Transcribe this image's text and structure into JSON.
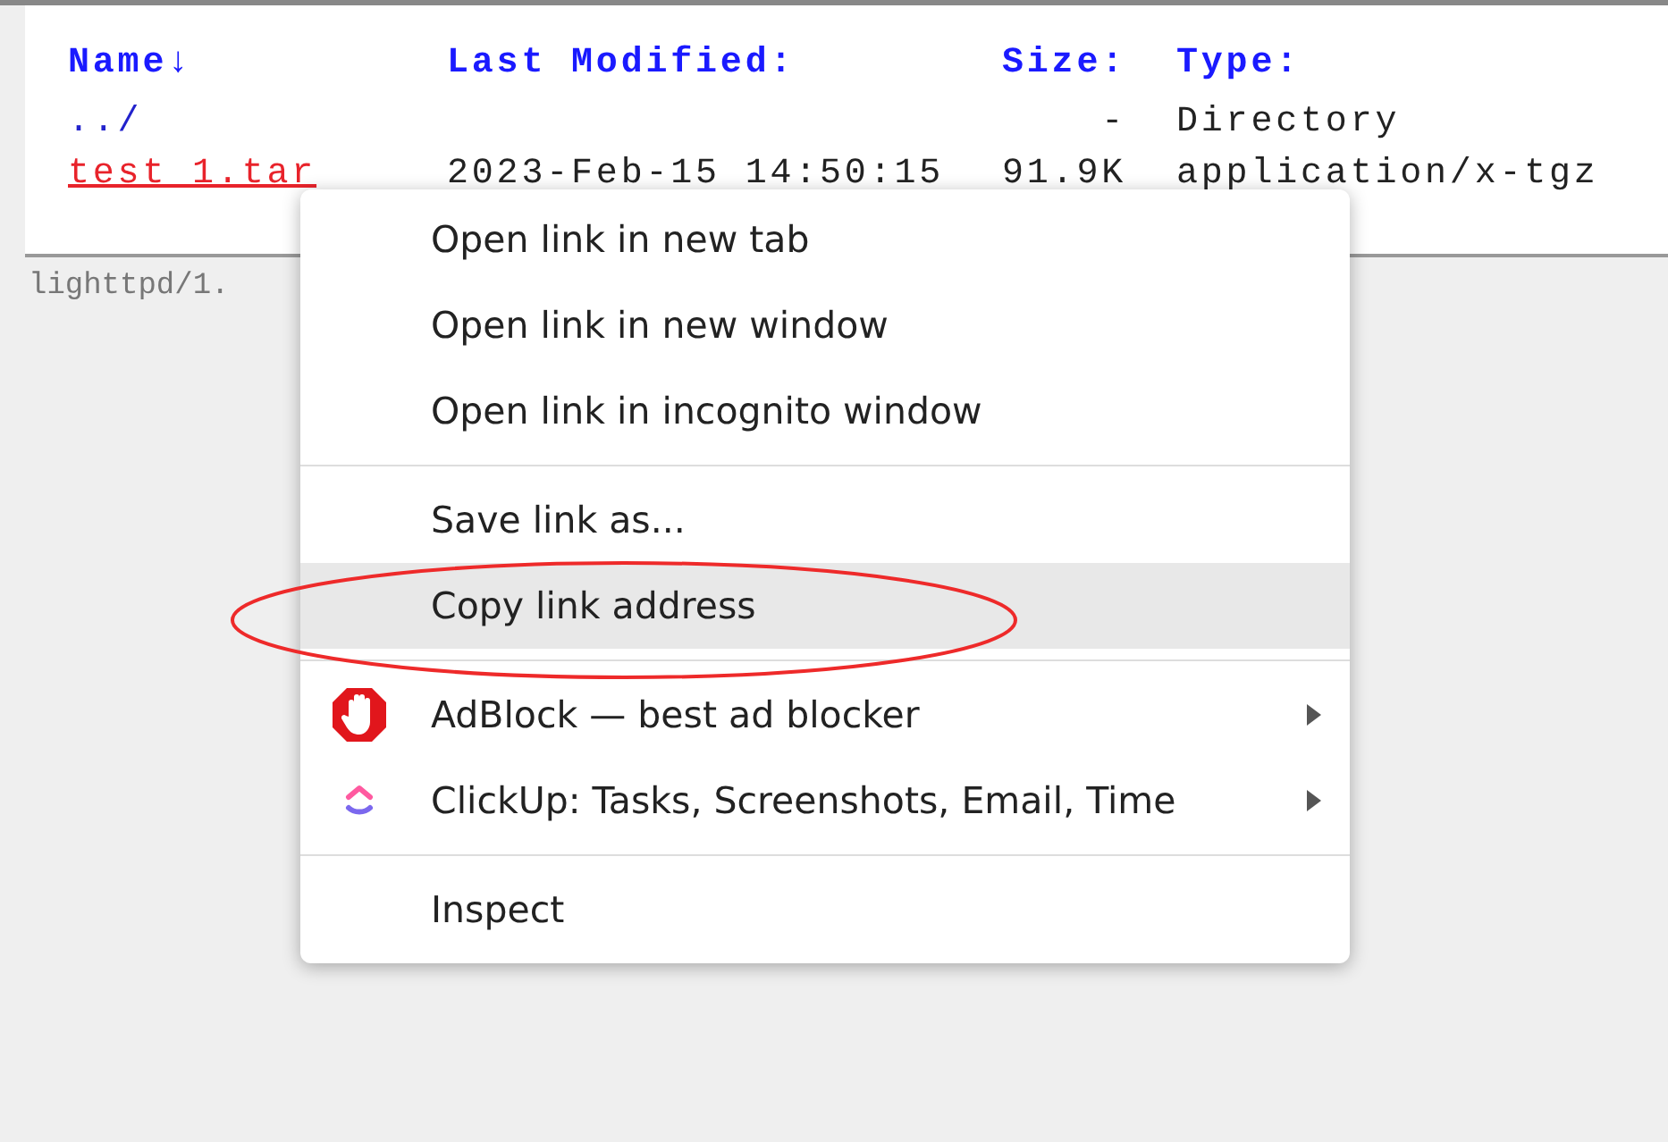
{
  "listing": {
    "columns": [
      "Name↓",
      "Last Modified:",
      "Size:",
      "Type:"
    ],
    "rows": [
      {
        "name": "../",
        "visited": false,
        "modified": "",
        "size": "-",
        "type": "Directory"
      },
      {
        "name": "test_1.tar",
        "visited": true,
        "modified": "2023-Feb-15 14:50:15",
        "size": "91.9K",
        "type": "application/x-tgz"
      }
    ]
  },
  "footer": "lighttpd/1.",
  "context_menu": {
    "items": [
      {
        "kind": "item",
        "label": "Open link in new tab",
        "selected": false
      },
      {
        "kind": "item",
        "label": "Open link in new window",
        "selected": false
      },
      {
        "kind": "item",
        "label": "Open link in incognito window",
        "selected": false
      },
      {
        "kind": "separator"
      },
      {
        "kind": "item",
        "label": "Save link as...",
        "selected": false
      },
      {
        "kind": "item",
        "label": "Copy link address",
        "selected": true
      },
      {
        "kind": "separator"
      },
      {
        "kind": "submenu",
        "label": "AdBlock — best ad blocker",
        "selected": false
      },
      {
        "kind": "submenu",
        "label": "ClickUp: Tasks, Screenshots, Email, Time",
        "selected": false
      },
      {
        "kind": "separator"
      },
      {
        "kind": "item",
        "label": "Inspect",
        "selected": false
      }
    ]
  }
}
